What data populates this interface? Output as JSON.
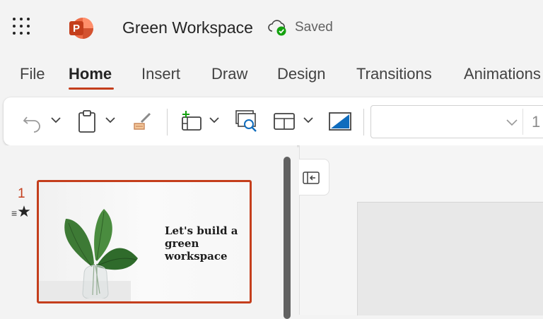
{
  "app": {
    "title": "Green Workspace",
    "save_status": "Saved",
    "icons": {
      "launcher": "app-launcher-icon",
      "logo": "powerpoint-logo-icon",
      "save": "cloud-saved-icon"
    }
  },
  "tabs": [
    {
      "label": "File",
      "active": false
    },
    {
      "label": "Home",
      "active": true
    },
    {
      "label": "Insert",
      "active": false
    },
    {
      "label": "Draw",
      "active": false
    },
    {
      "label": "Design",
      "active": false
    },
    {
      "label": "Transitions",
      "active": false
    },
    {
      "label": "Animations",
      "active": false
    }
  ],
  "toolbar": {
    "icons": [
      "undo-icon",
      "paste-icon",
      "format-painter-icon",
      "new-slide-icon",
      "reuse-slides-icon",
      "layout-icon",
      "background-icon"
    ],
    "font_name": "",
    "font_size": "1"
  },
  "slides": [
    {
      "number": "1",
      "marker": "★",
      "text": "Let's build a green workspace"
    }
  ],
  "colors": {
    "accent": "#c43e1c",
    "background": "#f3f3f3",
    "toolbar": "#ffffff"
  }
}
